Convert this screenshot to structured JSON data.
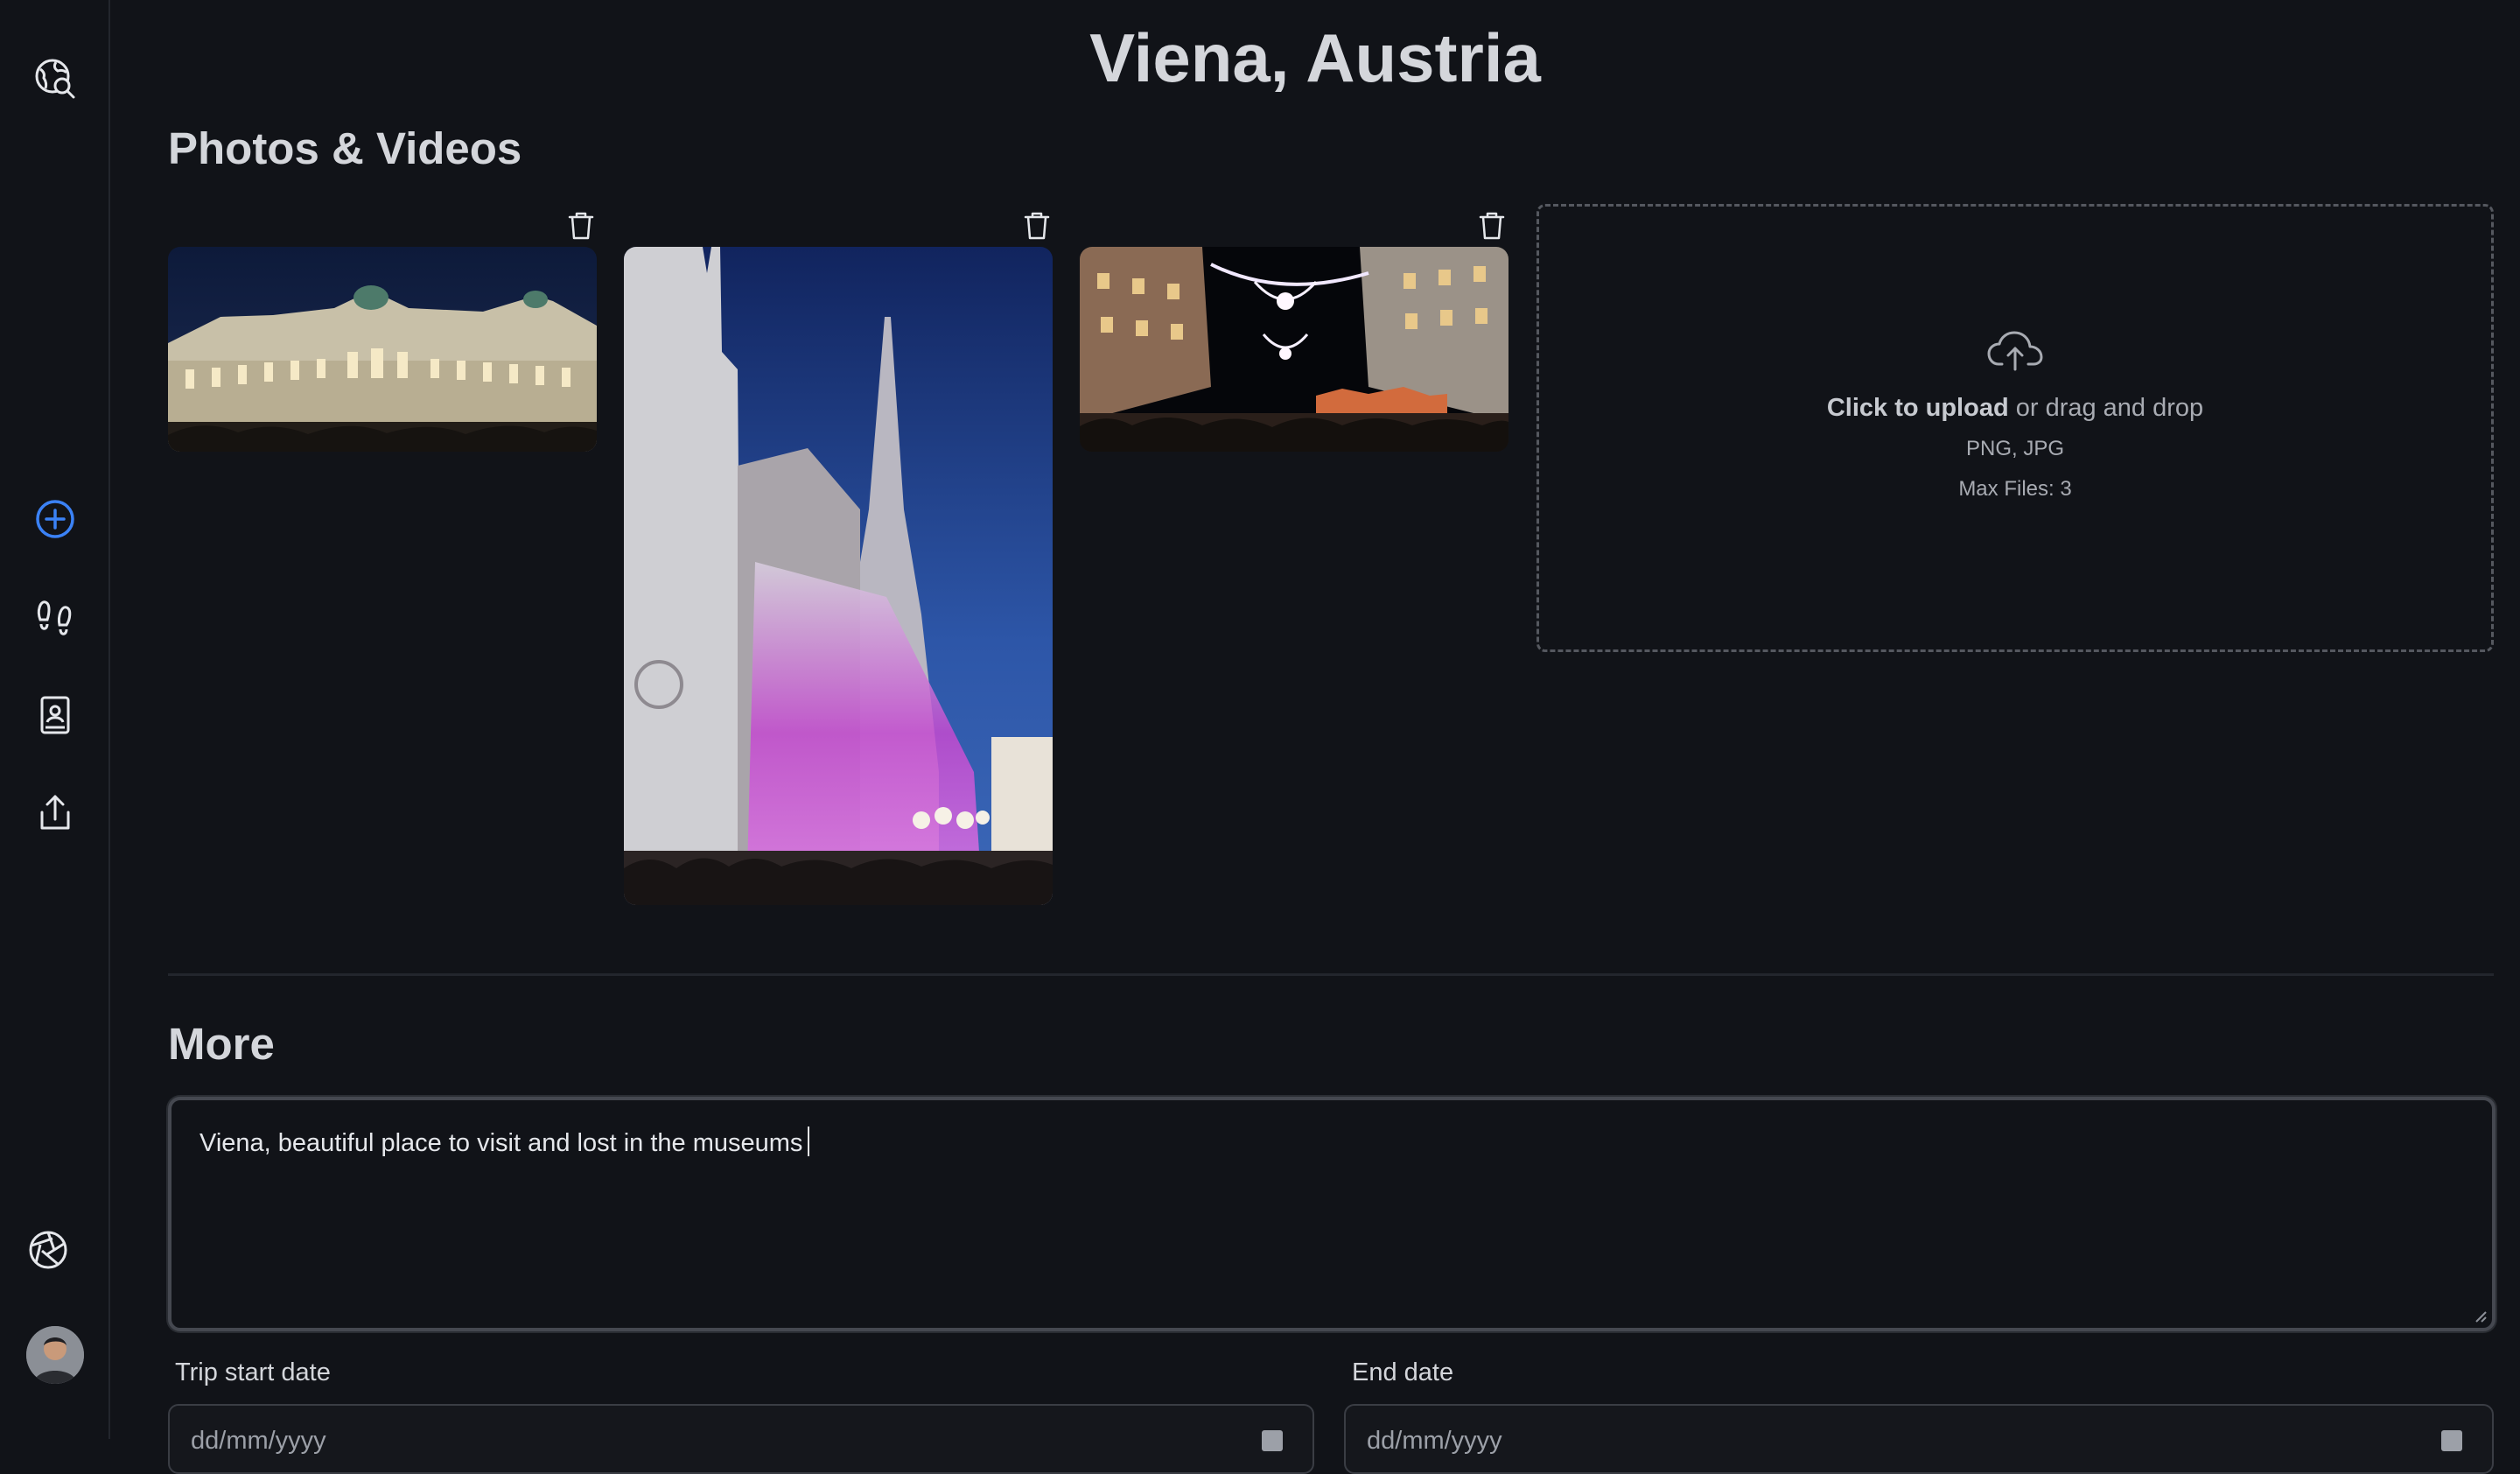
{
  "page": {
    "title": "Viena, Austria"
  },
  "sidebar": {
    "top_icon": "globe-search-icon",
    "items": [
      {
        "icon": "add-circle-icon",
        "color": "#3b82f6"
      },
      {
        "icon": "footprints-icon"
      },
      {
        "icon": "contact-book-icon"
      },
      {
        "icon": "share-upload-icon"
      }
    ],
    "bottom_icon": "aperture-icon",
    "avatar": "user-avatar"
  },
  "photos": {
    "heading": "Photos & Videos",
    "items": [
      {
        "name": "hofburg-palace-night",
        "delete_icon": "trash-icon"
      },
      {
        "name": "st-stephens-cathedral",
        "delete_icon": "trash-icon"
      },
      {
        "name": "christmas-lights-street",
        "delete_icon": "trash-icon"
      }
    ],
    "upload": {
      "icon": "cloud-upload-icon",
      "cta_bold": "Click to upload",
      "cta_rest": " or drag and drop",
      "formats": "PNG, JPG",
      "max_files": "Max Files: 3"
    }
  },
  "more": {
    "heading": "More",
    "notes_value": "Viena, beautiful place to visit and lost in the museums",
    "start_date_label": "Trip start date",
    "end_date_label": "End date",
    "start_date_value": "dd/mm/yyyy",
    "end_date_value": "dd/mm/yyyy"
  },
  "colors": {
    "background": "#111318",
    "accent": "#3b82f6",
    "text": "#d4d6db",
    "muted": "#a8abb2"
  }
}
